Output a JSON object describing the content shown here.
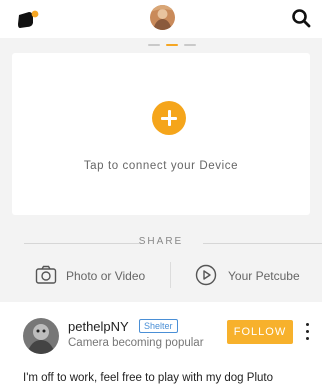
{
  "header": {
    "logo_icon": "petcube-logo-icon",
    "avatar": "user-avatar",
    "search_icon": "search-icon"
  },
  "pager": {
    "pages": 3,
    "active_index": 1,
    "active_color": "#f5a623"
  },
  "device_card": {
    "connect_label": "Tap to connect your Device",
    "plus_icon": "plus-circle-icon",
    "accent_color": "#f5a51b"
  },
  "share": {
    "heading": "SHARE",
    "options": [
      {
        "label": "Photo or Video",
        "icon": "camera-icon"
      },
      {
        "label": "Your Petcube",
        "icon": "play-circle-icon"
      }
    ]
  },
  "feed_item": {
    "username": "pethelpNY",
    "badge": "Shelter",
    "status": "Camera becoming popular",
    "follow_label": "FOLLOW",
    "more_icon": "more-vertical-icon",
    "post_text": "I'm off to work, feel free to play with my dog Pluto",
    "follow_color": "#f7b12c",
    "badge_color": "#4a8fd6"
  }
}
